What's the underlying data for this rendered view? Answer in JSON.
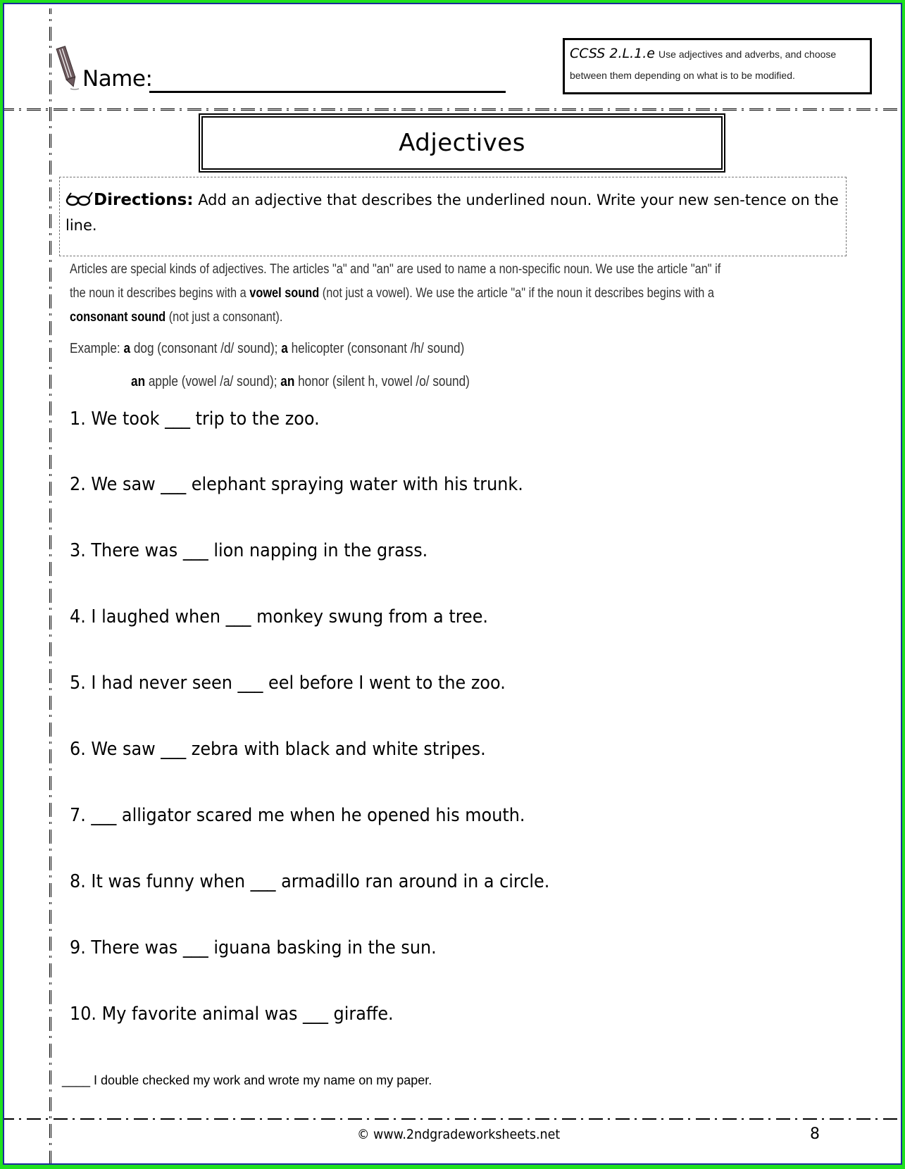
{
  "header": {
    "name_label": "Name:",
    "icon": "pencil-icon",
    "standard": {
      "code": "CCSS 2.L.1.e",
      "description_line1": "Use adjectives and adverbs, and choose",
      "description_line2": "between them depending on what is to be modified."
    }
  },
  "title": "Adjectives",
  "directions": {
    "icon": "glasses-icon",
    "label": "Directions:",
    "text": "Add an adjective that describes the underlined noun.  Write your new sen-tence on the line."
  },
  "articles": {
    "line1": "Articles are special kinds of adjectives.  The articles \"a\" and \"an\" are used to name a non-specific noun.  We use the article \"an\" if",
    "line2_a": "the noun it describes begins with a ",
    "line2_bold": "vowel sound",
    "line2_b": " (not just a vowel).  We use the article \"a\" if the noun it describes begins with a",
    "line3_bold": "consonant sound",
    "line3_b": " (not just a consonant)."
  },
  "example": {
    "prefix": "Example: ",
    "row1": [
      {
        "bold": "a",
        "text": " dog (consonant /d/ sound); "
      },
      {
        "bold": "a",
        "text": " helicopter (consonant /h/ sound)"
      }
    ],
    "row2": [
      {
        "bold": "an",
        "text": " apple (vowel /a/ sound); "
      },
      {
        "bold": "an",
        "text": " honor (silent h, vowel /o/ sound)"
      }
    ]
  },
  "questions": [
    "1.  We took ___ trip to the zoo.",
    "2.  We saw ___ elephant spraying water with his trunk.",
    "3.  There was ___ lion napping in the grass.",
    "4.  I laughed when ___ monkey swung from a tree.",
    "5. I had never seen ___ eel before I went to the zoo.",
    "6.  We saw ___ zebra with black and white stripes.",
    "7.  ___ alligator scared me when he opened his mouth.",
    "8. It was funny when ___ armadillo ran around in a circle.",
    "9.   There was ___ iguana basking in the sun.",
    "10.  My favorite animal was ___ giraffe."
  ],
  "checklist": "____ I double checked my work and wrote my name on my  paper.",
  "footer": {
    "copyright": "© www.2ndgradeworksheets.net",
    "page_number": "8"
  },
  "colors": {
    "frame_outer": "#1fe01f",
    "frame_inner": "#1b2a9c"
  }
}
